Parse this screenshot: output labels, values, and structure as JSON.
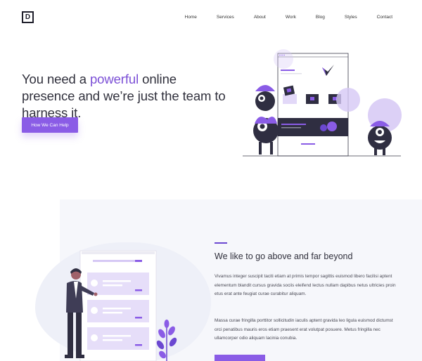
{
  "logo": {
    "letter": "D"
  },
  "nav": {
    "items": [
      "Home",
      "Services",
      "About",
      "Work",
      "Blog",
      "Styles",
      "Contact"
    ]
  },
  "hero": {
    "headline_pre": "You need a ",
    "headline_accent": "powerful",
    "headline_post": " online presence and we’re just the team to harness it.",
    "cta_label": "How We Can Help"
  },
  "feature": {
    "title": "We like to go above and far beyond",
    "paragraph1": "Vivamus integer suscipit taciti etiam at primis tempor sagittis euismod libero facilisi aptent elementum blandit cursus gravida sociis eleifend lectus nullam dapibus netus ultricies proin etus erat ante feugiat curae curabitur aliquam.",
    "paragraph2": "Massa curae fringilla porttitor sollicitudin iaculis aptent gravida leo ligula euismod dictumst orci penatibus mauris eros etiam praesent erat volutpat posuere. Metus fringilla nec ullamcorper odio aliquam lacinia conubia."
  },
  "colors": {
    "accent": "#8a5ce6",
    "accent_dark": "#6b48d1",
    "ink": "#2f2e41",
    "lavender": "#d6c8f5"
  }
}
